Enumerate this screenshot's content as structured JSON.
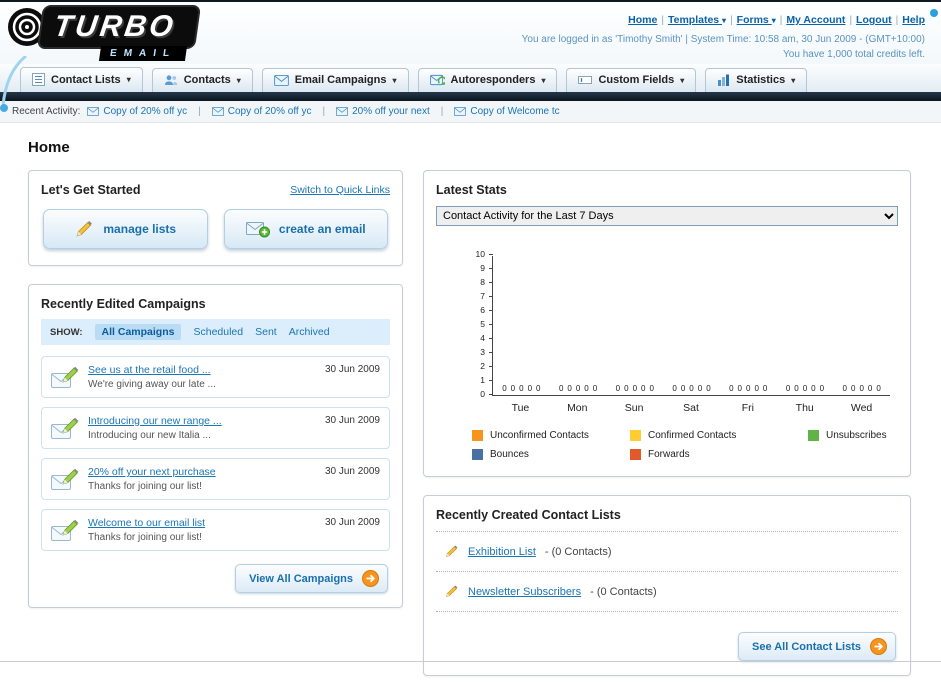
{
  "header": {
    "logo_main": "TURBO",
    "logo_sub": "EMAIL",
    "nav_links": [
      {
        "label": "Home",
        "dropdown": false
      },
      {
        "label": "Templates",
        "dropdown": true
      },
      {
        "label": "Forms",
        "dropdown": true
      },
      {
        "label": "My Account",
        "dropdown": false
      },
      {
        "label": "Logout",
        "dropdown": false
      },
      {
        "label": "Help",
        "dropdown": false
      }
    ],
    "login_info": "You are logged in as 'Timothy Smith' | System Time: 10:58 am, 30 Jun 2009 - (GMT+10:00)",
    "credits": "You have 1,000 total credits left."
  },
  "main_nav": [
    {
      "label": "Contact Lists",
      "icon": "list"
    },
    {
      "label": "Contacts",
      "icon": "users"
    },
    {
      "label": "Email Campaigns",
      "icon": "envelope"
    },
    {
      "label": "Autoresponders",
      "icon": "autoresponder"
    },
    {
      "label": "Custom Fields",
      "icon": "field"
    },
    {
      "label": "Statistics",
      "icon": "chart-bars"
    }
  ],
  "recent_activity": {
    "label": "Recent Activity:",
    "items": [
      "Copy of 20% off yc",
      "Copy of 20% off yc",
      "20% off your next",
      "Copy of Welcome tc"
    ]
  },
  "page_title": "Home",
  "get_started": {
    "title": "Let's Get Started",
    "switch_link": "Switch to Quick Links",
    "buttons": [
      {
        "label": "manage lists",
        "icon": "pencil"
      },
      {
        "label": "create an email",
        "icon": "envelope-plus"
      }
    ]
  },
  "campaigns": {
    "title": "Recently Edited Campaigns",
    "show_label": "SHOW:",
    "tabs": [
      "All Campaigns",
      "Scheduled",
      "Sent",
      "Archived"
    ],
    "selected_tab": "All Campaigns",
    "items": [
      {
        "title": "See us at the retail food ...",
        "subtitle": "We're giving away our late ...",
        "date": "30 Jun 2009"
      },
      {
        "title": "Introducing our new range ...",
        "subtitle": "Introducing our new Italia ...",
        "date": "30 Jun 2009"
      },
      {
        "title": "20% off your next purchase",
        "subtitle": "Thanks for joining our list!",
        "date": "30 Jun 2009"
      },
      {
        "title": "Welcome to our email list",
        "subtitle": "Thanks for joining our list!",
        "date": "30 Jun 2009"
      }
    ],
    "view_all": "View All Campaigns"
  },
  "stats": {
    "title": "Latest Stats",
    "dropdown_value": "Contact Activity for the Last 7 Days",
    "chart_data": {
      "type": "bar",
      "title": "Contact Activity for the Last 7 Days",
      "categories": [
        "Tue",
        "Mon",
        "Sun",
        "Sat",
        "Fri",
        "Thu",
        "Wed"
      ],
      "series": [
        {
          "name": "Unconfirmed Contacts",
          "color": "#f7941d",
          "values": [
            0,
            0,
            0,
            0,
            0,
            0,
            0
          ]
        },
        {
          "name": "Confirmed Contacts",
          "color": "#ffcc33",
          "values": [
            0,
            0,
            0,
            0,
            0,
            0,
            0
          ]
        },
        {
          "name": "Unsubscribes",
          "color": "#5fb445",
          "values": [
            0,
            0,
            0,
            0,
            0,
            0,
            0
          ]
        },
        {
          "name": "Bounces",
          "color": "#4a6fa5",
          "values": [
            0,
            0,
            0,
            0,
            0,
            0,
            0
          ]
        },
        {
          "name": "Forwards",
          "color": "#e05a2b",
          "values": [
            0,
            0,
            0,
            0,
            0,
            0,
            0
          ]
        }
      ],
      "ylim": [
        0,
        10
      ],
      "ytick_step": 1,
      "grid": false,
      "legend_position": "bottom"
    }
  },
  "contact_lists": {
    "title": "Recently Created Contact Lists",
    "items": [
      {
        "name": "Exhibition List",
        "suffix": "- (0 Contacts)"
      },
      {
        "name": "Newsletter Subscribers",
        "suffix": "- (0 Contacts)"
      }
    ],
    "see_all": "See All Contact Lists"
  }
}
